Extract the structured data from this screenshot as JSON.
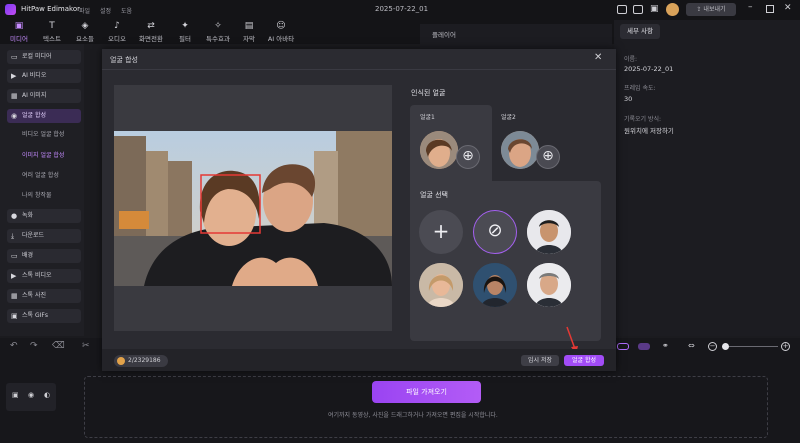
{
  "app": {
    "name": "HitPaw Edimakor",
    "project_date": "2025-07-22_01",
    "menu": [
      "파일",
      "설정",
      "도움"
    ],
    "export_label": "내보내기"
  },
  "toolbar": [
    {
      "label": "미디어",
      "icon": "media-icon"
    },
    {
      "label": "텍스트",
      "icon": "text-icon"
    },
    {
      "label": "요소들",
      "icon": "elements-icon"
    },
    {
      "label": "오디오",
      "icon": "audio-icon"
    },
    {
      "label": "화면전환",
      "icon": "transition-icon"
    },
    {
      "label": "필터",
      "icon": "filter-icon"
    },
    {
      "label": "특수효과",
      "icon": "effects-icon"
    },
    {
      "label": "자막",
      "icon": "subtitle-icon"
    },
    {
      "label": "AI 아바타",
      "icon": "ai-avatar-icon"
    }
  ],
  "sidebar": {
    "items": [
      {
        "label": "로컬 미디어"
      },
      {
        "label": "AI 비디오"
      },
      {
        "label": "AI 이미지"
      },
      {
        "label": "얼굴 합성"
      }
    ],
    "sub_items": [
      "비디오 얼굴 합성",
      "이미지 얼굴 합성",
      "여러 얼굴 합성",
      "나의 창작물"
    ],
    "items2": [
      {
        "label": "녹화"
      },
      {
        "label": "다운로드"
      },
      {
        "label": "배경"
      },
      {
        "label": "스톡 비디오"
      },
      {
        "label": "스톡 사진"
      },
      {
        "label": "스톡 GIFs"
      }
    ]
  },
  "player": {
    "title": "플레이어"
  },
  "details": {
    "tab": "세부 사항",
    "name_label": "이름:",
    "name_value": "2025-07-22_01",
    "fps_label": "프레임 속도:",
    "fps_value": "30",
    "save_label": "기록오기 방식:",
    "save_value": "원위치에 저장하기"
  },
  "modal": {
    "title": "얼굴 합성",
    "recognized_title": "인식된 얼굴",
    "faces": [
      {
        "label": "얼굴1"
      },
      {
        "label": "얼굴2"
      }
    ],
    "select_title": "얼굴 선택",
    "credit": "2/2329186",
    "temp_save": "임시 저장",
    "apply": "얼굴 합성"
  },
  "timeline": {
    "import_button": "파일 가져오기",
    "hint": "여기까지 동영상, 사진을 드래그하거나 가져오면 편집을 시작합니다."
  },
  "colors": {
    "accent": "#a24cf7",
    "face_box": "#e53935",
    "bg": "#1b1b1f",
    "modal": "#2b2b31"
  }
}
